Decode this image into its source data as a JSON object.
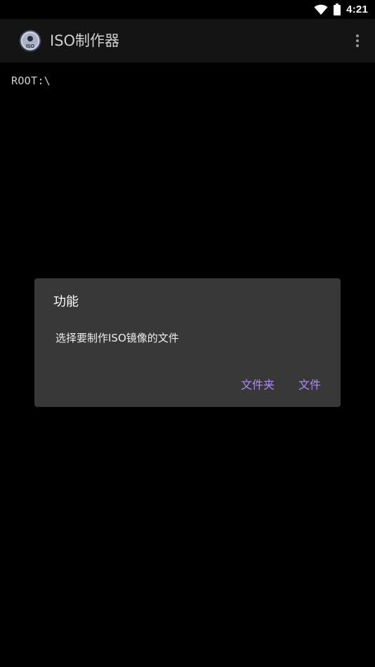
{
  "status_bar": {
    "time": "4:21",
    "icons": [
      "wifi-icon",
      "battery-icon"
    ]
  },
  "app_bar": {
    "title": "ISO制作器",
    "app_icon_text": "ISO",
    "overflow_icon": "more-vert-icon"
  },
  "main": {
    "path": "ROOT:\\"
  },
  "dialog": {
    "title": "功能",
    "message": "选择要制作ISO镜像的文件",
    "buttons": {
      "folder": "文件夹",
      "file": "文件"
    }
  },
  "colors": {
    "background": "#000000",
    "app_bar": "#141414",
    "dialog_bg": "#383838",
    "accent": "#b388ff"
  }
}
